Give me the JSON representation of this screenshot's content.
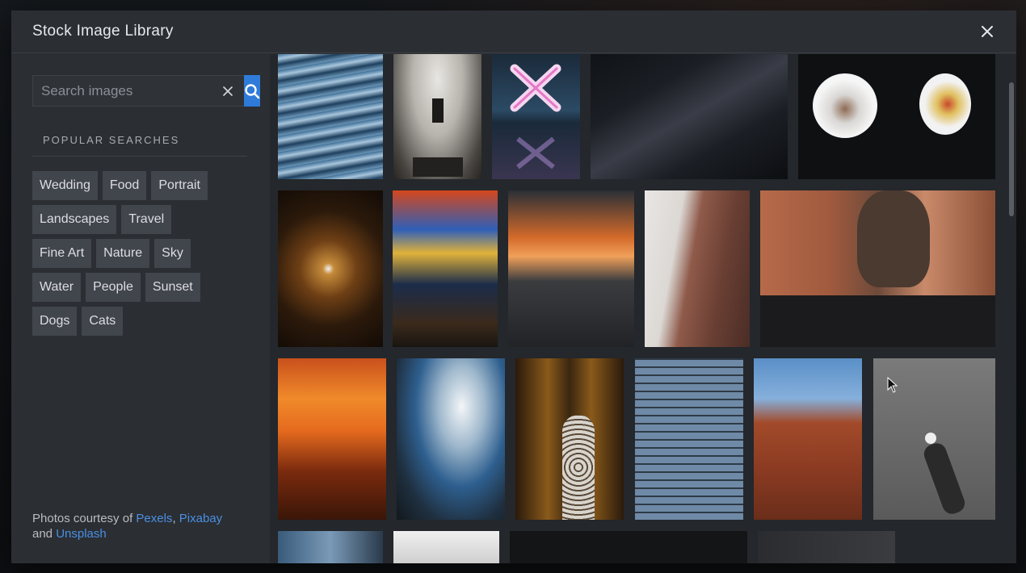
{
  "modal": {
    "title": "Stock Image Library",
    "close_icon": "close-icon"
  },
  "search": {
    "placeholder": "Search images",
    "value": "",
    "clear_icon": "clear-icon",
    "button_icon": "search-icon"
  },
  "popular": {
    "heading": "POPULAR SEARCHES",
    "tags": [
      "Wedding",
      "Food",
      "Portrait",
      "Landscapes",
      "Travel",
      "Fine Art",
      "Nature",
      "Sky",
      "Water",
      "People",
      "Sunset",
      "Dogs",
      "Cats"
    ]
  },
  "credits": {
    "prefix": "Photos courtesy of ",
    "link1": "Pexels",
    "sep1": ", ",
    "link2": "Pixabay",
    "sep2": " and ",
    "link3": "Unsplash"
  },
  "colors": {
    "accent": "#2f7bd9",
    "link": "#4a90e2"
  }
}
